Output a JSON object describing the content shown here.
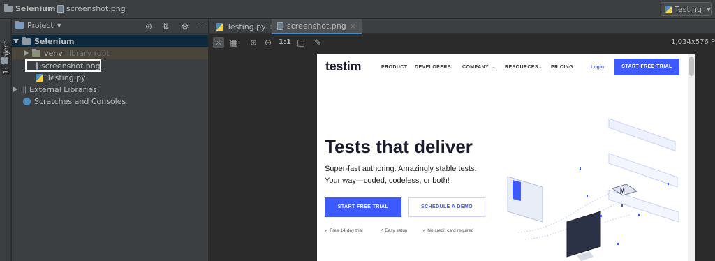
{
  "navbar": {
    "project": "Selenium",
    "file": "screenshot.png",
    "run_config": "Testing"
  },
  "tool_stripe": {
    "project_label": "1: Project"
  },
  "project_panel": {
    "view_label": "Project",
    "tree": {
      "root": "Selenium",
      "venv": "venv",
      "venv_note": "library root",
      "screenshot": "screenshot.png",
      "testing": "Testing.py",
      "external": "External Libraries",
      "scratches": "Scratches and Consoles"
    }
  },
  "tabs": [
    {
      "label": "Testing.py"
    },
    {
      "label": "screenshot.png"
    }
  ],
  "image_toolbar": {
    "actual_size": "1:1",
    "dimensions": "1,034x576 P"
  },
  "webpage": {
    "logo": "testim",
    "nav": [
      "PRODUCT",
      "DEVELOPERS",
      "COMPANY",
      "RESOURCES",
      "PRICING"
    ],
    "login": "Login",
    "cta_header": "START FREE TRIAL",
    "headline": "Tests that deliver",
    "subline1": "Super-fast authoring. Amazingly stable tests.",
    "subline2": "Your way—coded, codeless, or both!",
    "cta_primary": "START FREE TRIAL",
    "cta_secondary": "SCHEDULE A DEMO",
    "checks": [
      "Free 14-day trial",
      "Easy setup",
      "No credit card required"
    ]
  },
  "colors": {
    "ide_bg": "#2b2b2b",
    "panel_bg": "#3c3f41",
    "selection": "#0d293e",
    "brand_blue": "#3d5afe"
  }
}
